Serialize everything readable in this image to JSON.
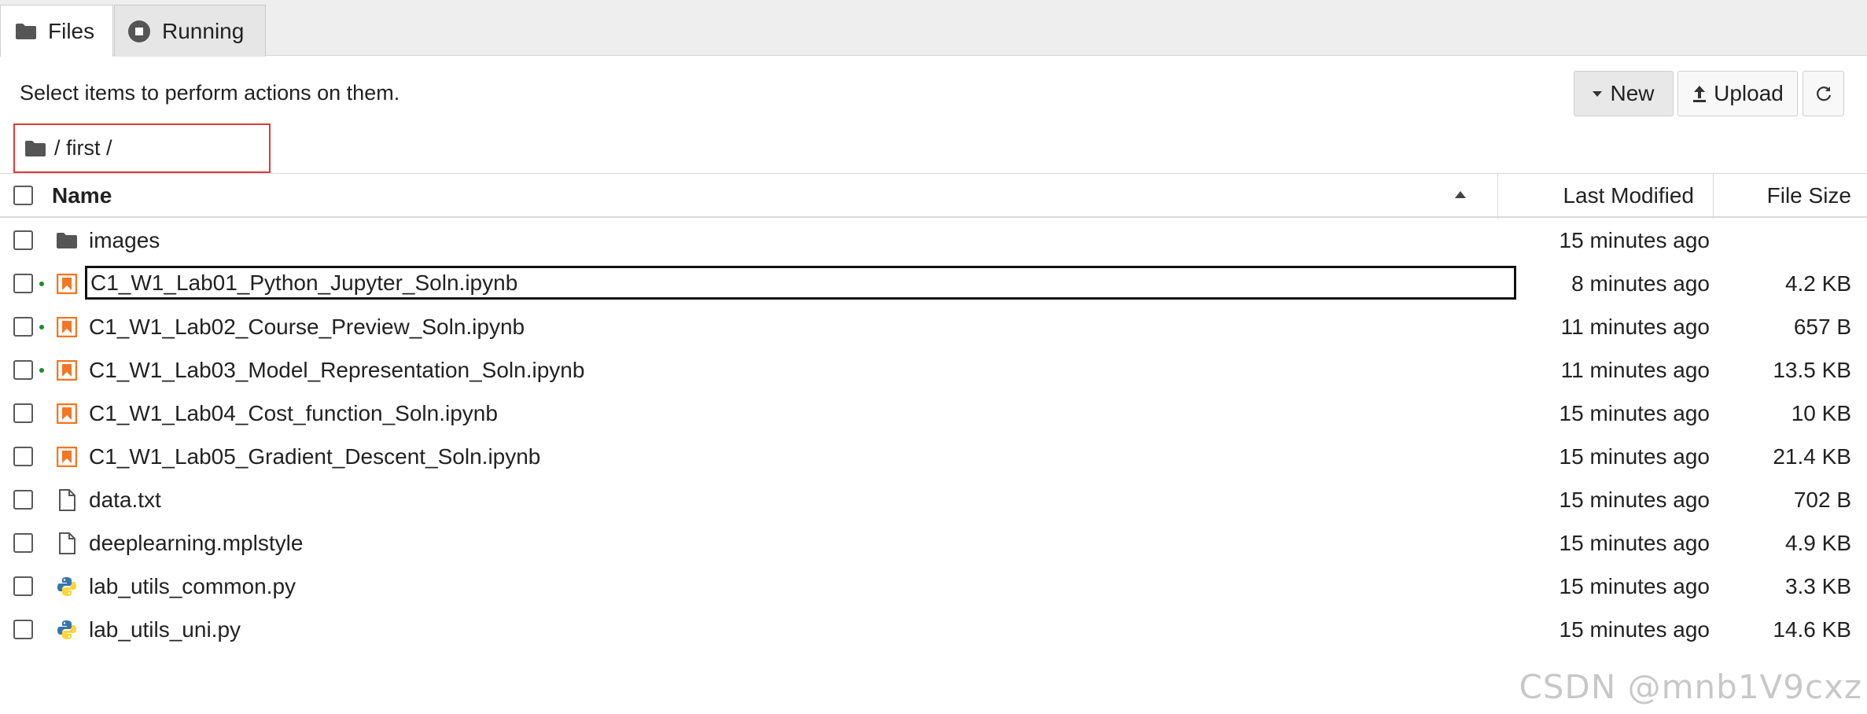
{
  "tabs": [
    {
      "label": "Files",
      "icon": "folder-icon"
    },
    {
      "label": "Running",
      "icon": "stop-circle-icon"
    }
  ],
  "hint": "Select items to perform actions on them.",
  "toolbar": {
    "new_label": "New",
    "upload_label": "Upload",
    "refresh_icon": "refresh-icon"
  },
  "breadcrumb": "/ first /",
  "table": {
    "headers": {
      "name": "Name",
      "last_modified": "Last Modified",
      "file_size": "File Size"
    },
    "rows": [
      {
        "name": "images",
        "type": "folder",
        "modified": "15 minutes ago",
        "size": "",
        "running": false
      },
      {
        "name": "C1_W1_Lab01_Python_Jupyter_Soln.ipynb",
        "type": "notebook",
        "modified": "8 minutes ago",
        "size": "4.2 KB",
        "running": true
      },
      {
        "name": "C1_W1_Lab02_Course_Preview_Soln.ipynb",
        "type": "notebook",
        "modified": "11 minutes ago",
        "size": "657 B",
        "running": true
      },
      {
        "name": "C1_W1_Lab03_Model_Representation_Soln.ipynb",
        "type": "notebook",
        "modified": "11 minutes ago",
        "size": "13.5 KB",
        "running": true
      },
      {
        "name": "C1_W1_Lab04_Cost_function_Soln.ipynb",
        "type": "notebook",
        "modified": "15 minutes ago",
        "size": "10 KB",
        "running": false
      },
      {
        "name": "C1_W1_Lab05_Gradient_Descent_Soln.ipynb",
        "type": "notebook",
        "modified": "15 minutes ago",
        "size": "21.4 KB",
        "running": false
      },
      {
        "name": "data.txt",
        "type": "file",
        "modified": "15 minutes ago",
        "size": "702 B",
        "running": false
      },
      {
        "name": "deeplearning.mplstyle",
        "type": "file",
        "modified": "15 minutes ago",
        "size": "4.9 KB",
        "running": false
      },
      {
        "name": "lab_utils_common.py",
        "type": "python",
        "modified": "15 minutes ago",
        "size": "3.3 KB",
        "running": false
      },
      {
        "name": "lab_utils_uni.py",
        "type": "python",
        "modified": "15 minutes ago",
        "size": "14.6 KB",
        "running": false
      }
    ]
  },
  "watermark": "CSDN @mnb1V9cxz",
  "colors": {
    "running_dot": "#1e8a2e",
    "notebook_orange": "#f37626",
    "breadcrumb_highlight": "#e03a3a"
  }
}
